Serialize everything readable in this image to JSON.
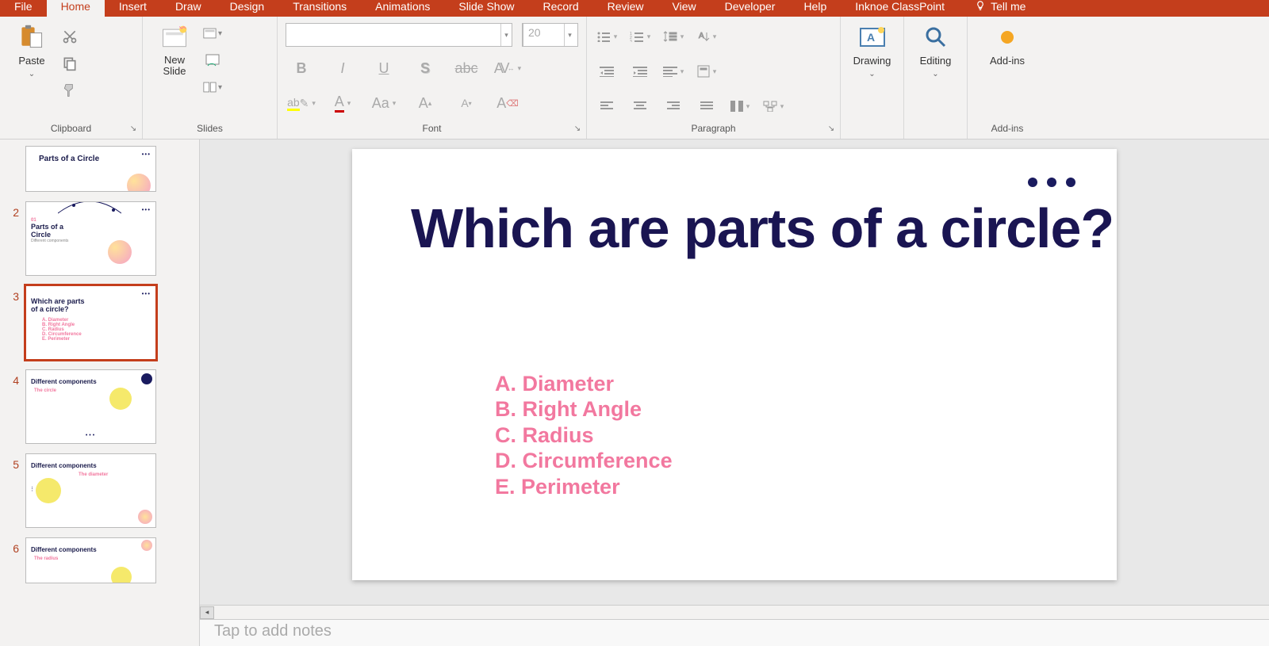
{
  "tabs": {
    "file": "File",
    "home": "Home",
    "insert": "Insert",
    "draw": "Draw",
    "design": "Design",
    "transitions": "Transitions",
    "animations": "Animations",
    "slideshow": "Slide Show",
    "record": "Record",
    "review": "Review",
    "view": "View",
    "developer": "Developer",
    "help": "Help",
    "classpoint": "Inknoe ClassPoint",
    "tellme": "Tell me"
  },
  "ribbon": {
    "clipboard": {
      "label": "Clipboard",
      "paste": "Paste"
    },
    "slides": {
      "label": "Slides",
      "newslide": "New\nSlide"
    },
    "font": {
      "label": "Font",
      "size": "20"
    },
    "paragraph": {
      "label": "Paragraph"
    },
    "drawing": {
      "label": "Drawing",
      "btn": "Drawing"
    },
    "editing": {
      "label": "Editing",
      "btn": "Editing"
    },
    "addins": {
      "label": "Add-ins",
      "btn": "Add-ins"
    }
  },
  "thumbs": {
    "n2": "2",
    "n3": "3",
    "n4": "4",
    "n5": "5",
    "n6": "6",
    "t1_title": "Parts of a Circle",
    "t2_num": "01",
    "t2_title": "Parts of a\nCircle",
    "t2_sub": "Different components",
    "t3_title": "Which are parts\nof a circle?",
    "t3_a": "A. Diameter",
    "t3_b": "B. Right Angle",
    "t3_c": "C. Radius",
    "t3_d": "D. Circumference",
    "t3_e": "E. Perimeter",
    "t4_title": "Different components",
    "t4_sub": "The circle",
    "t5_title": "Different components",
    "t5_sub": "The diameter",
    "t6_title": "Different components",
    "t6_sub": "The radius"
  },
  "slide": {
    "title": "Which are parts of a circle?",
    "a": "A. Diameter",
    "b": "B. Right Angle",
    "c": "C. Radius",
    "d": "D. Circumference",
    "e": "E. Perimeter"
  },
  "notes": {
    "placeholder": "Tap to add notes"
  }
}
